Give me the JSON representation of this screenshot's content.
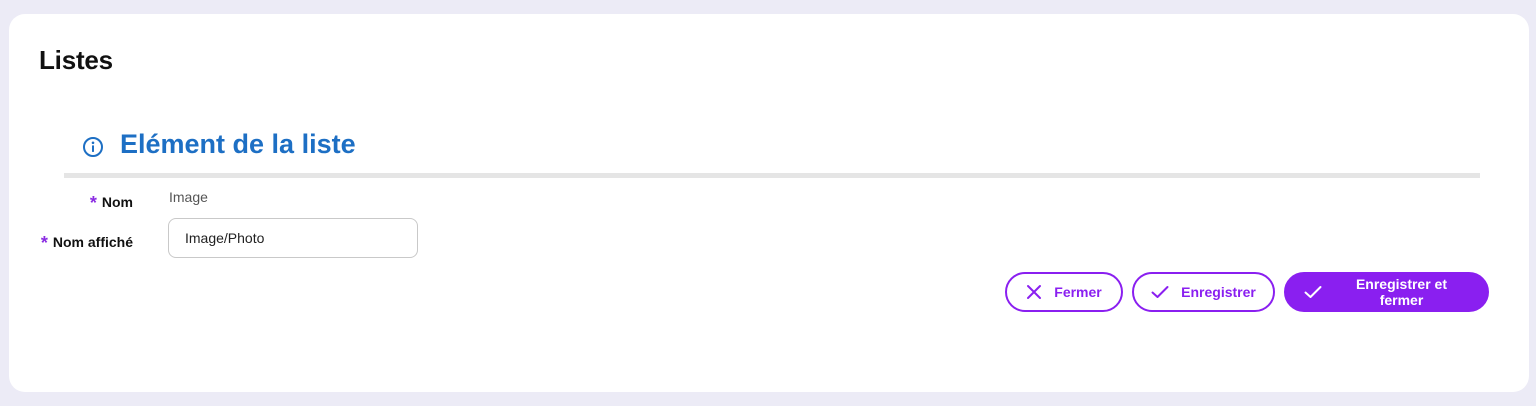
{
  "page": {
    "title": "Listes"
  },
  "section": {
    "icon": "info-icon",
    "title": "Elément de la liste",
    "accent_color": "#1d6fc4"
  },
  "form": {
    "required_marker": "*",
    "nom": {
      "label": "Nom",
      "value": "Image"
    },
    "nom_affiche": {
      "label": "Nom affiché",
      "value": "Image/Photo"
    }
  },
  "actions": {
    "fermer": {
      "label": "Fermer",
      "icon": "close-icon"
    },
    "enregistrer": {
      "label": "Enregistrer",
      "icon": "check-icon"
    },
    "enregistrer_fermer": {
      "label": "Enregistrer et fermer",
      "icon": "check-icon"
    },
    "primary_color": "#8a1ff0"
  }
}
